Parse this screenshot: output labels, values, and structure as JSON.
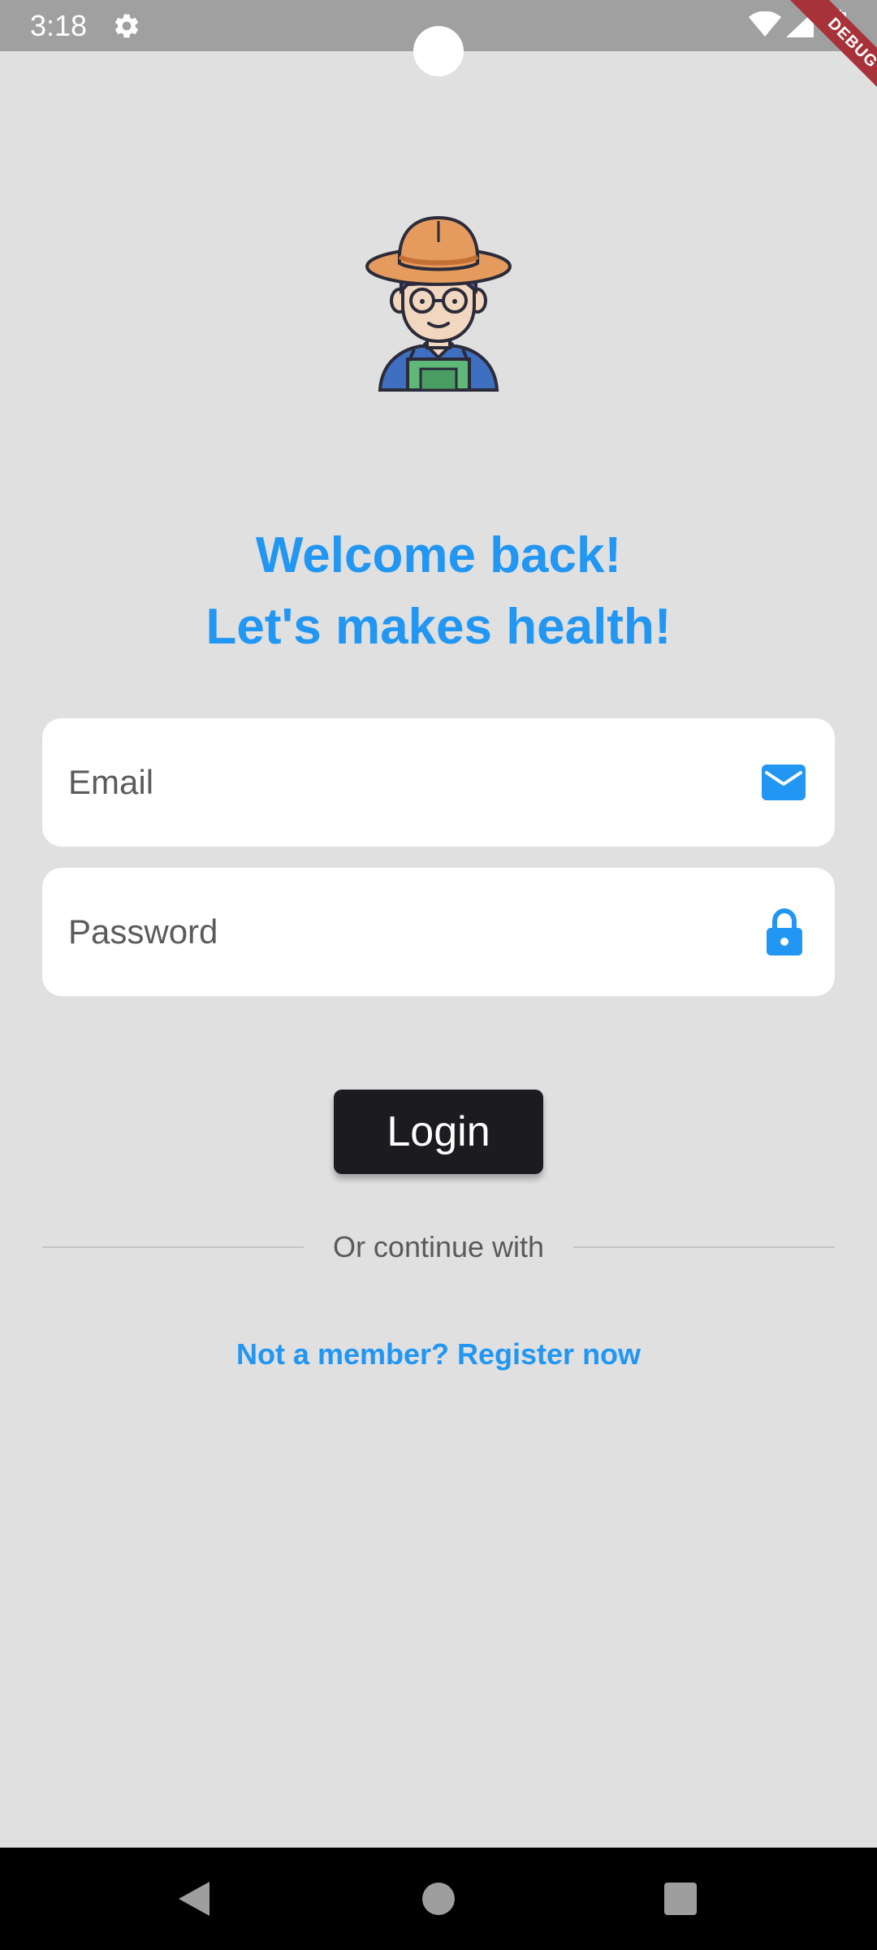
{
  "status_bar": {
    "time": "3:18",
    "icons": [
      "gear-icon",
      "wifi-icon",
      "signal-icon",
      "battery-icon"
    ]
  },
  "debug_banner": {
    "label": "DEBUG",
    "color": "#a8323a"
  },
  "header": {
    "avatar_icon": "farmer-avatar-icon",
    "welcome_line_1": "Welcome back!",
    "welcome_line_2": "Let's makes health!"
  },
  "form": {
    "email": {
      "placeholder": "Email",
      "icon": "mail-icon"
    },
    "password": {
      "placeholder": "Password",
      "icon": "lock-icon"
    },
    "login_label": "Login"
  },
  "divider": {
    "label": "Or continue with"
  },
  "register": {
    "label": "Not a member? Register now"
  },
  "nav_bar": {
    "icons": [
      "back-icon",
      "home-icon",
      "recents-icon"
    ]
  },
  "colors": {
    "accent": "#2196f3",
    "background": "#e0e0e0",
    "button": "#1c1b20",
    "status_bar": "#a0a0a0"
  }
}
